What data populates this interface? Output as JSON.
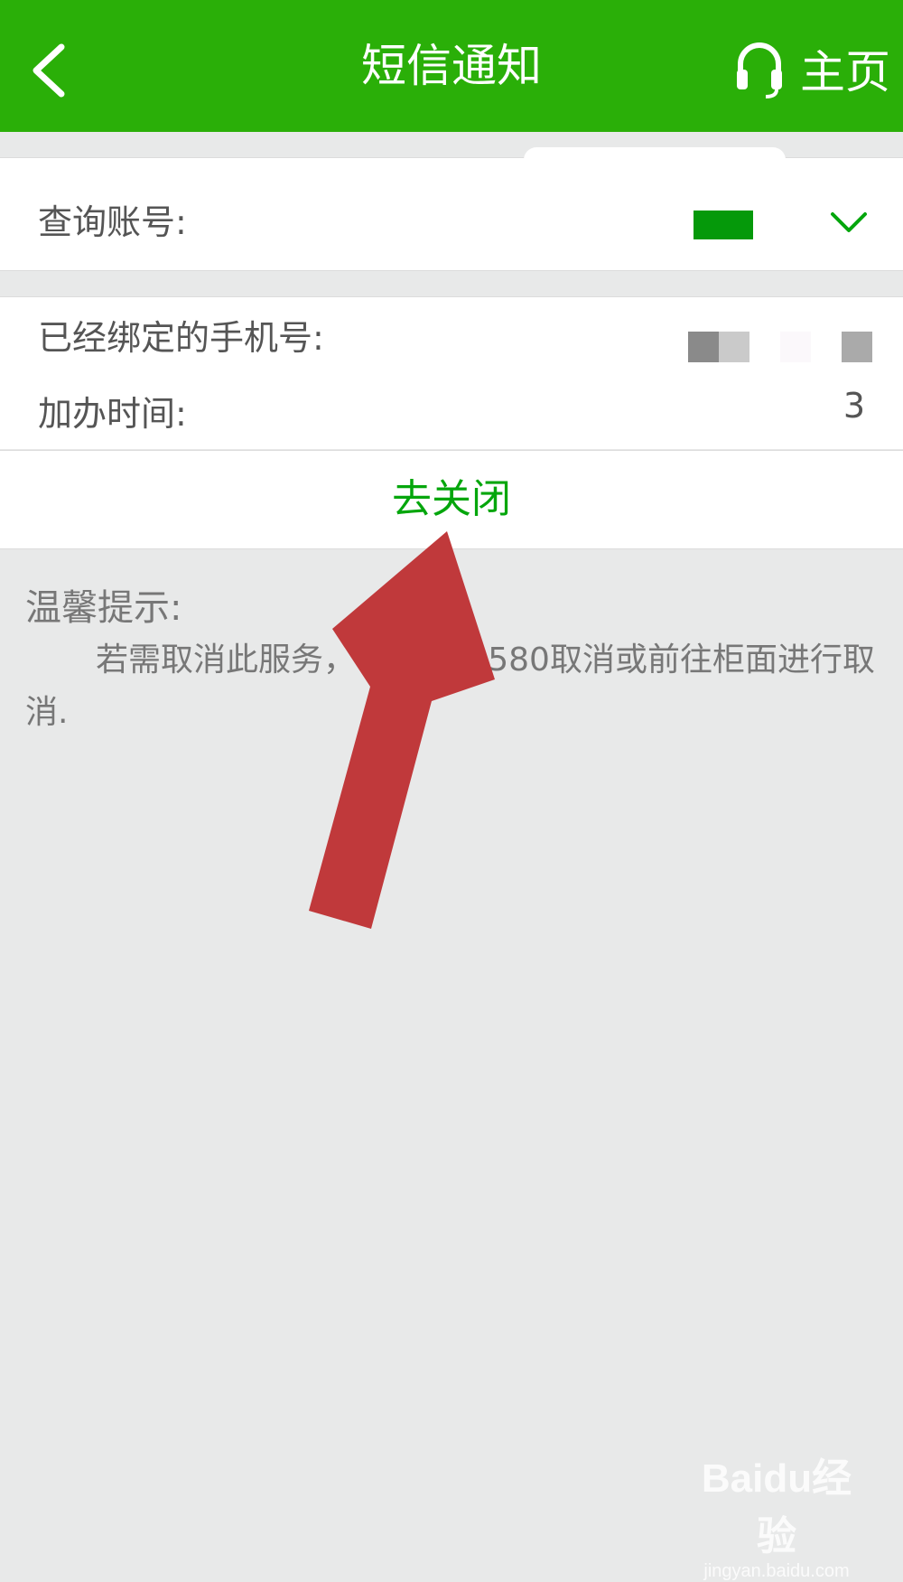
{
  "nav": {
    "title": "短信通知",
    "home_label": "主页"
  },
  "account": {
    "label": "查询账号:",
    "value": ""
  },
  "binding": {
    "phone_label": "已经绑定的手机号:",
    "time_label": "加办时间:",
    "time_value": "3"
  },
  "action": {
    "close_label": "去关闭"
  },
  "tips": {
    "title": "温馨提示:",
    "body": "若需取消此服务，    QX至95580取消或前往柜面进行取消."
  },
  "colors": {
    "nav_bg": "#2aaf08",
    "action_text": "#04a60c",
    "arrow": "#c0393b"
  },
  "watermark": {
    "logo": "Baidu经验",
    "url": "jingyan.baidu.com"
  }
}
